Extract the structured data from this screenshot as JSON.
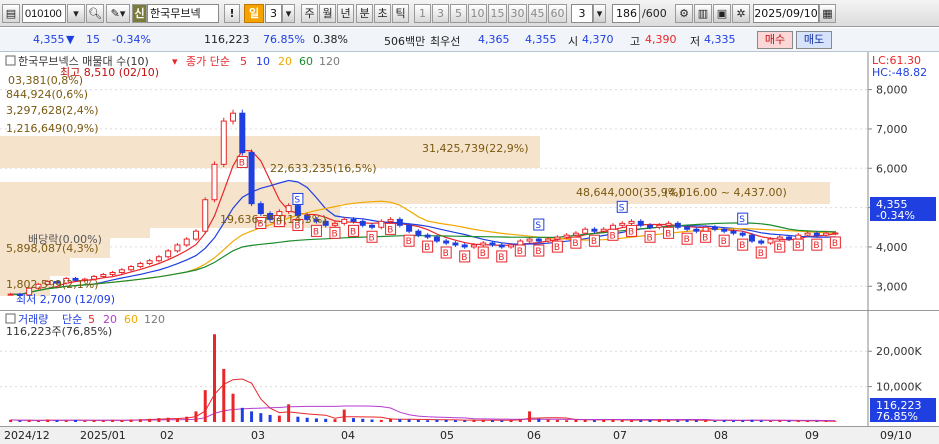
{
  "toolbar": {
    "code": "010100",
    "stock_badge": "신",
    "stock_name": "한국무브넥",
    "alert": "!",
    "period_selected": "일",
    "count_value": "3",
    "periods": [
      "주",
      "월",
      "년",
      "분",
      "초",
      "틱"
    ],
    "intervals": [
      "1",
      "3",
      "5",
      "10",
      "15",
      "30",
      "45",
      "60"
    ],
    "small_value": "3",
    "page": "186",
    "page_total": "/600",
    "date": "2025/09/10"
  },
  "quote": {
    "price": "4,355",
    "direction": "▼",
    "change": "15",
    "change_pct": "-0.34%",
    "volume": "116,223",
    "volume_ratio": "76.85%",
    "turnover": "0.38%",
    "amount": "506백만",
    "best_label": "최우선",
    "best_ask": "4,365",
    "best_bid": "4,355",
    "open_label": "시",
    "open": "4,370",
    "high_label": "고",
    "high": "4,390",
    "low_label": "저",
    "low": "4,335",
    "buy_label": "매수",
    "sell_label": "매도"
  },
  "price_chart": {
    "legend_title": "한국무브넥스 매물대 수(10)",
    "legend_ma_label": "종가 단순",
    "ma_periods": [
      "5",
      "10",
      "20",
      "60",
      "120"
    ],
    "ma_colors": [
      "#e8262a",
      "#1f3fe0",
      "#f0a800",
      "#1a8c2e",
      "#7a7a7a"
    ],
    "lc_label": "LC:61.30",
    "hc_label": "HC:-48.82",
    "volume_profile": [
      "03,381(0,8%)",
      "844,924(0,6%)",
      "3,297,628(2,4%)",
      "1,216,649(0,9%)",
      "31,425,739(22,9%)",
      "22,633,235(16,5%)",
      "48,644,000(35,9%)",
      "19,636,754(14,3%)",
      "5,898,087(4,3%)",
      "1,802,599(2,1%)"
    ],
    "high_marker": "최고 8,510 (02/10)",
    "low_marker": "최저 2,700 (12/09)",
    "dividend_label": "배당락(0.00%)",
    "range_label": "(4,016.00 ~ 4,437.00)",
    "y_ticks": [
      "8,000",
      "7,000",
      "6,000",
      "5,000",
      "4,000",
      "3,000"
    ],
    "last_price": "4,355",
    "last_change": "-0.34%",
    "signal_b": "B",
    "signal_s": "S"
  },
  "volume_chart": {
    "legend_title": "거래량",
    "legend_ma_label": "단순",
    "ma_periods": [
      "5",
      "20",
      "60",
      "120"
    ],
    "ma_colors": [
      "#e8262a",
      "#b53bd0",
      "#f0a800",
      "#7a7a7a"
    ],
    "value_label": "116,223주(76,85%)",
    "y_ticks": [
      "20,000K",
      "10,000K"
    ],
    "last_volume": "116,223",
    "last_ratio": "76.85%"
  },
  "date_axis": {
    "labels": [
      "2024/12",
      "2025/01",
      "02",
      "03",
      "04",
      "05",
      "06",
      "07",
      "08",
      "09"
    ],
    "right_label": "09/10"
  },
  "colors": {
    "up": "#e8262a",
    "down": "#1f3fe0",
    "profile": "#f6e3cc",
    "profile_text": "#7a5a10"
  },
  "chart_data": {
    "type": "candlestick",
    "ylim": [
      2600,
      8600
    ],
    "close": [
      2800,
      2780,
      2950,
      3050,
      3120,
      3080,
      3200,
      3150,
      3180,
      3250,
      3300,
      3350,
      3420,
      3500,
      3580,
      3650,
      3750,
      3900,
      4050,
      4200,
      4400,
      5200,
      6100,
      7200,
      7400,
      6400,
      5100,
      4850,
      4700,
      4900,
      5050,
      4800,
      4700,
      4650,
      4550,
      4600,
      4700,
      4650,
      4550,
      4500,
      4650,
      4700,
      4550,
      4400,
      4300,
      4250,
      4150,
      4100,
      4050,
      4000,
      4050,
      4100,
      4050,
      4000,
      4050,
      4150,
      4200,
      4150,
      4200,
      4250,
      4300,
      4350,
      4450,
      4400,
      4450,
      4550,
      4600,
      4650,
      4550,
      4500,
      4550,
      4600,
      4500,
      4450,
      4400,
      4500,
      4450,
      4400,
      4350,
      4300,
      4150,
      4100,
      4200,
      4250,
      4200,
      4300,
      4350,
      4300,
      4350,
      4355
    ],
    "volume_k": [
      600,
      400,
      500,
      350,
      700,
      500,
      400,
      600,
      300,
      500,
      400,
      600,
      500,
      700,
      800,
      900,
      1100,
      1200,
      900,
      1500,
      3000,
      9000,
      24800,
      15000,
      8000,
      4000,
      3000,
      2500,
      2000,
      1800,
      5000,
      1500,
      1200,
      1000,
      900,
      800,
      3500,
      1100,
      900,
      700,
      600,
      1000,
      800,
      700,
      600,
      500,
      700,
      600,
      500,
      400,
      500,
      600,
      500,
      400,
      600,
      800,
      3000,
      900,
      700,
      600,
      500,
      700,
      600,
      500,
      600,
      700,
      500,
      400,
      500,
      600,
      700,
      500,
      400,
      600,
      500,
      400,
      300,
      500,
      400,
      500,
      600,
      400,
      300,
      400,
      300,
      400,
      300,
      200,
      150,
      116
    ]
  }
}
